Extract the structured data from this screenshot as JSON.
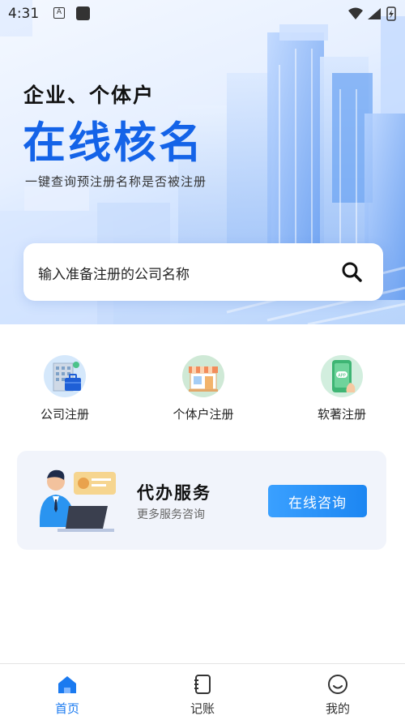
{
  "status_bar": {
    "time": "4:31",
    "notification_letter": "A"
  },
  "hero": {
    "kicker": "企业、个体户",
    "title": "在线核名",
    "subtitle": "一键查询预注册名称是否被注册"
  },
  "search": {
    "placeholder": "输入准备注册的公司名称",
    "icon": "search-icon"
  },
  "services": [
    {
      "label": "公司注册",
      "icon": "company-building-icon"
    },
    {
      "label": "个体户注册",
      "icon": "storefront-icon"
    },
    {
      "label": "软著注册",
      "icon": "app-phone-icon"
    }
  ],
  "agency": {
    "title": "代办服务",
    "subtitle": "更多服务咨询",
    "button_label": "在线咨询"
  },
  "tabs": [
    {
      "label": "首页",
      "icon": "home-icon",
      "active": true
    },
    {
      "label": "记账",
      "icon": "notebook-icon",
      "active": false
    },
    {
      "label": "我的",
      "icon": "smiley-icon",
      "active": false
    }
  ],
  "colors": {
    "accent": "#1a7af0",
    "hero_title": "#1463e8",
    "button": "#1c86f2"
  }
}
